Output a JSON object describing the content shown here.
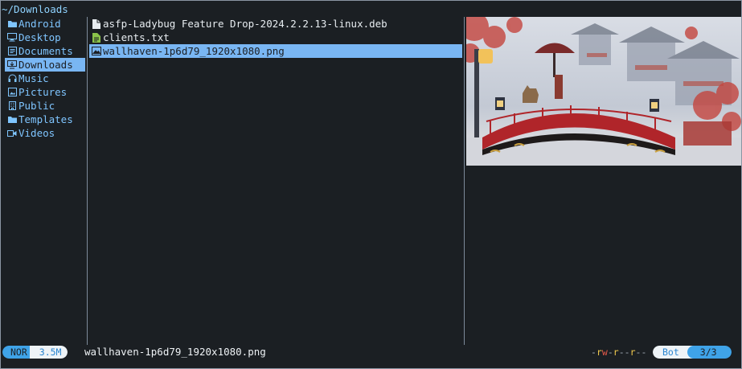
{
  "path": "~/Downloads",
  "parent_items": [
    {
      "label": "Android",
      "icon": "folder-icon"
    },
    {
      "label": "Desktop",
      "icon": "monitor-icon"
    },
    {
      "label": "Documents",
      "icon": "document-icon"
    },
    {
      "label": "Downloads",
      "icon": "download-icon",
      "selected": true
    },
    {
      "label": "Music",
      "icon": "headphones-icon"
    },
    {
      "label": "Pictures",
      "icon": "picture-icon"
    },
    {
      "label": "Public",
      "icon": "building-icon"
    },
    {
      "label": "Templates",
      "icon": "folder-icon"
    },
    {
      "label": "Videos",
      "icon": "video-icon"
    }
  ],
  "files": [
    {
      "label": "asfp-Ladybug Feature Drop-2024.2.2.13-linux.deb",
      "icon": "package-file-icon"
    },
    {
      "label": "clients.txt",
      "icon": "text-file-icon"
    },
    {
      "label": "wallhaven-1p6d79_1920x1080.png",
      "icon": "image-file-icon",
      "selected": true
    }
  ],
  "status": {
    "mode": "NOR",
    "size": "3.5M",
    "filename": "wallhaven-1p6d79_1920x1080.png",
    "permissions": "-rw-r--r--",
    "position": "Bot",
    "count": "3/3"
  },
  "colors": {
    "background": "#1b1f23",
    "directory": "#7fc5ff",
    "selection": "#79b6f3",
    "accent": "#3fa3e8"
  }
}
